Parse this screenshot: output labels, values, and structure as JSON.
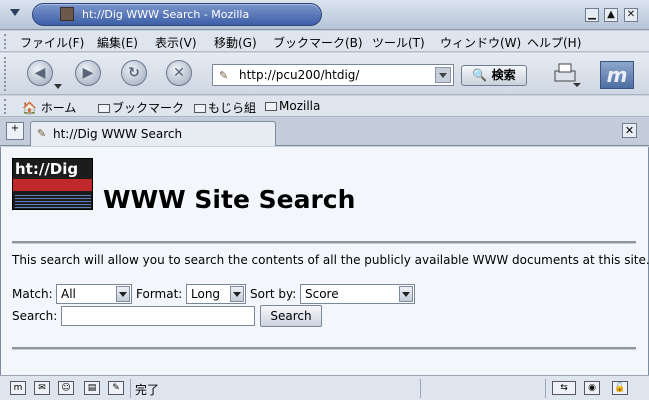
{
  "window": {
    "title": "ht://Dig WWW Search - Mozilla"
  },
  "menubar": {
    "items": [
      "ファイル(F)",
      "編集(E)",
      "表示(V)",
      "移動(G)",
      "ブックマーク(B)",
      "ツール(T)",
      "ウィンドウ(W)",
      "ヘルプ(H)"
    ]
  },
  "navbar": {
    "url": "http://pcu200/htdig/",
    "search_label": "検索"
  },
  "personal_bar": {
    "items": [
      "ホーム",
      "ブックマーク",
      "もじら組",
      "Mozilla"
    ]
  },
  "tab": {
    "label": "ht://Dig WWW Search"
  },
  "page": {
    "logo_text": "ht://Dig",
    "heading": "WWW Site Search",
    "description": "This search will allow you to search the contents of all the publicly available WWW documents at this site.",
    "match_label": "Match:",
    "match_value": "All",
    "format_label": "Format:",
    "format_value": "Long",
    "sort_label": "Sort by:",
    "sort_value": "Score",
    "search_label": "Search:",
    "search_value": "",
    "search_button": "Search"
  },
  "statusbar": {
    "text": "完了"
  },
  "colors": {
    "content_bg": "#f3f6fb",
    "chrome_bg": "#dfe5ee",
    "title_accent": "#3e5fa8"
  }
}
